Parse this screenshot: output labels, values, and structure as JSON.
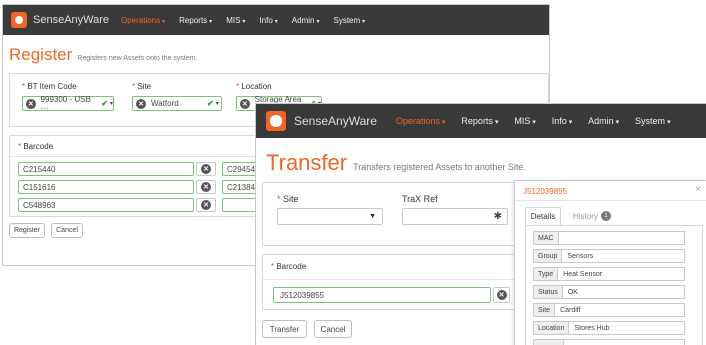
{
  "brand": {
    "name": "SenseAnyWare",
    "accent": "#f26522"
  },
  "nav": {
    "items": [
      {
        "label": "Operations",
        "active": true
      },
      {
        "label": "Reports"
      },
      {
        "label": "MIS"
      },
      {
        "label": "Info"
      },
      {
        "label": "Admin"
      },
      {
        "label": "System"
      }
    ]
  },
  "register": {
    "title": "Register",
    "subtitle": "Registers new Assets onto the system.",
    "fields": {
      "bt_item_code": {
        "label": "BT Item Code",
        "value": "999300 - USB ···"
      },
      "site": {
        "label": "Site",
        "value": "Watford"
      },
      "location": {
        "label": "Location",
        "value": "Storage Area 1"
      }
    },
    "barcode_label": "Barcode",
    "barcodes_left": [
      "C215440",
      "C151616",
      "C548963"
    ],
    "barcodes_right": [
      "C294541",
      "C213848",
      ""
    ],
    "buttons": {
      "register": "Register",
      "cancel": "Cancel"
    }
  },
  "transfer": {
    "title": "Transfer",
    "subtitle": "Transfers registered Assets to another Site.",
    "site_label": "Site",
    "trax_label": "TraX Ref",
    "barcode_label": "Barcode",
    "barcode_value": "J512039855",
    "buttons": {
      "transfer": "Transfer",
      "cancel": "Cancel"
    }
  },
  "popup": {
    "title": "J512039855",
    "tabs": {
      "details": "Details",
      "history": "History",
      "history_count": "1"
    },
    "rows": [
      {
        "key": "MAC",
        "value": ""
      },
      {
        "key": "Group",
        "value": "Sensors"
      },
      {
        "key": "Type",
        "value": "Heat Sensor"
      },
      {
        "key": "Status",
        "value": "OK"
      },
      {
        "key": "Site",
        "value": "Cardiff"
      },
      {
        "key": "Location",
        "value": "Stores Hub"
      }
    ]
  }
}
